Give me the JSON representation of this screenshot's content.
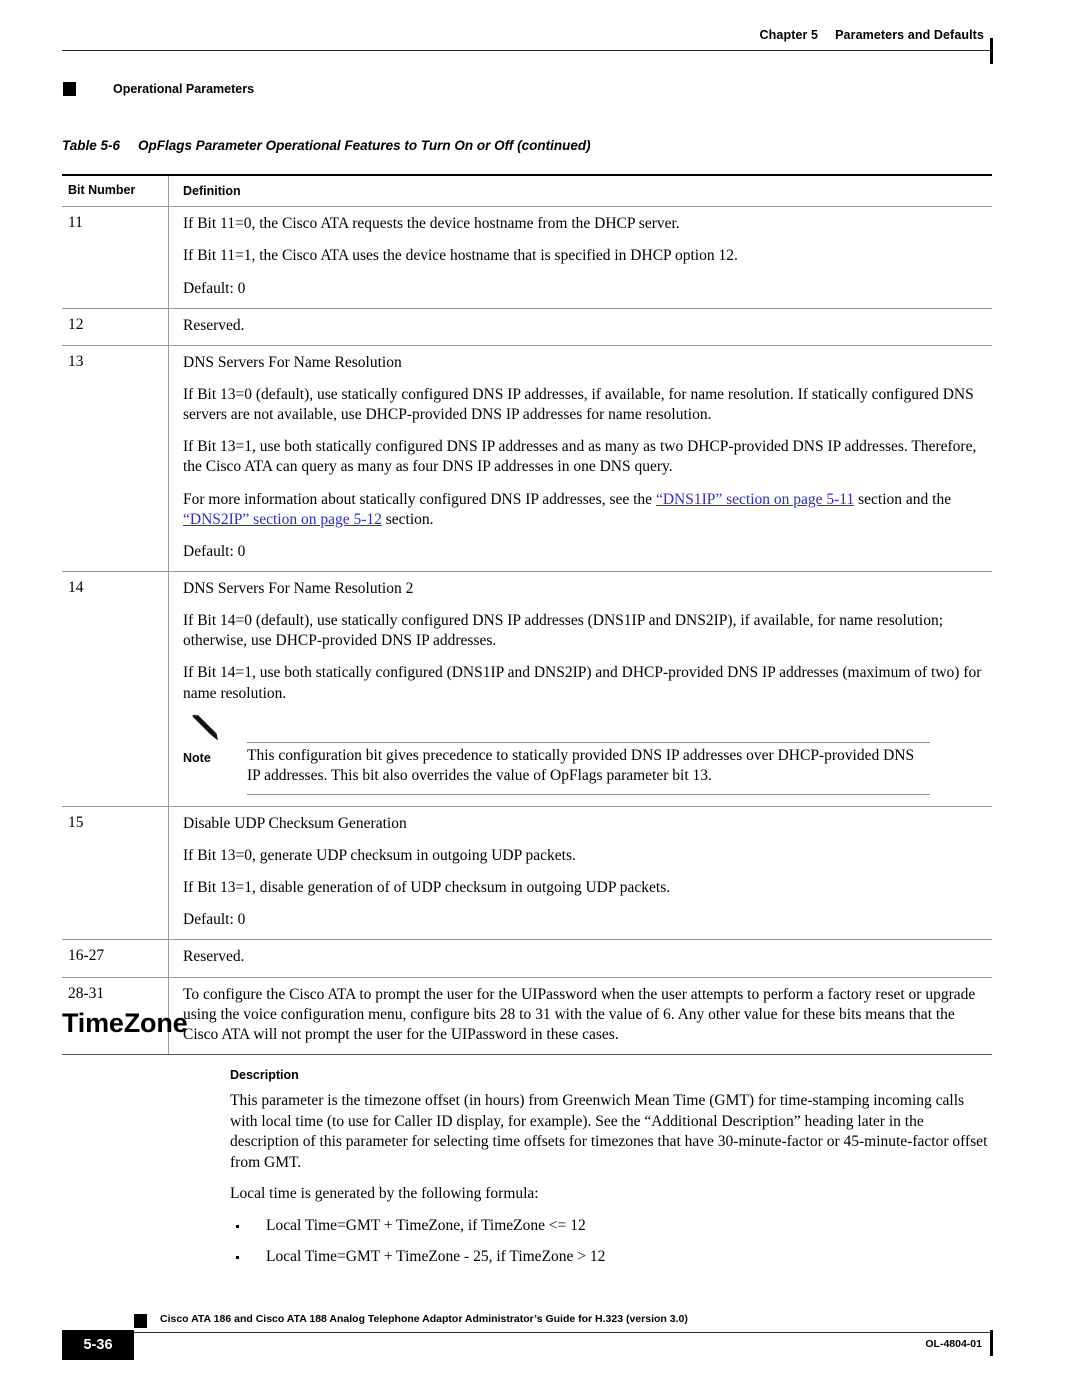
{
  "header": {
    "chapter": "Chapter 5",
    "chapter_title": "Parameters and Defaults",
    "section": "Operational Parameters",
    "square_icon": "black-square-icon"
  },
  "table": {
    "caption_number": "Table 5-6",
    "caption_title": "OpFlags Parameter Operational Features to Turn On or Off  (continued)",
    "columns": [
      "Bit Number",
      "Definition"
    ],
    "rows": [
      {
        "bit": "11",
        "paragraphs": [
          "If Bit 11=0, the Cisco ATA requests the device hostname from the DHCP server.",
          "If Bit 11=1, the Cisco ATA uses the device hostname that is specified in DHCP option 12.",
          "Default: 0"
        ]
      },
      {
        "bit": "12",
        "paragraphs": [
          "Reserved."
        ]
      },
      {
        "bit": "13",
        "paragraphs": [
          "DNS Servers For Name Resolution",
          "If Bit 13=0 (default), use statically configured DNS IP addresses, if available, for name resolution. If statically configured DNS servers are not available, use DHCP-provided DNS IP addresses for name resolution.",
          "If Bit 13=1, use both statically configured DNS IP addresses and as many as two DHCP-provided DNS IP addresses. Therefore, the Cisco ATA can query as many as four DNS IP addresses in one DNS query.",
          "Default: 0"
        ],
        "link_paragraph": {
          "pre": "For more information about statically configured DNS IP addresses, see the ",
          "link1": "“DNS1IP” section on page 5-11",
          "mid": " section and the ",
          "link2": "“DNS2IP” section on page 5-12",
          "post": " section."
        }
      },
      {
        "bit": "14",
        "paragraphs": [
          "DNS Servers For Name Resolution 2",
          "If Bit 14=0 (default), use statically configured DNS IP addresses (DNS1IP and DNS2IP), if available, for name resolution; otherwise, use DHCP-provided DNS IP addresses.",
          "If Bit 14=1, use both statically configured (DNS1IP and DNS2IP) and DHCP-provided DNS IP addresses (maximum of two) for name resolution."
        ],
        "note": {
          "icon": "pencil-icon",
          "label": "Note",
          "text": "This configuration bit gives precedence to statically provided DNS IP addresses over DHCP-provided DNS IP addresses. This bit also overrides the value of OpFlags parameter bit 13."
        }
      },
      {
        "bit": "15",
        "paragraphs": [
          "Disable UDP Checksum Generation",
          "If Bit 13=0, generate UDP checksum in outgoing UDP packets.",
          "If Bit 13=1, disable generation of of UDP checksum in outgoing UDP packets.",
          "Default: 0"
        ]
      },
      {
        "bit": "16-27",
        "paragraphs": [
          "Reserved."
        ]
      },
      {
        "bit": "28-31",
        "paragraphs": [
          "To configure the Cisco ATA to prompt the user for the UIPassword when the user attempts to perform a factory reset or upgrade using the voice configuration menu, configure bits 28 to 31 with the value of 6. Any other value for these bits means that the Cisco ATA will not prompt the user for the UIPassword in these cases."
        ]
      }
    ]
  },
  "section": {
    "heading": "TimeZone",
    "subheading": "Description",
    "paragraphs": [
      "This parameter is the timezone offset (in hours) from Greenwich Mean Time (GMT) for time-stamping incoming calls with local time (to use for Caller ID display, for example). See the “Additional Description” heading later in the description of this parameter for selecting time offsets for timezones that have 30-minute-factor or 45-minute-factor offset from GMT.",
      "Local time is generated by the following formula:"
    ],
    "bullets": [
      "Local Time=GMT + TimeZone, if TimeZone <= 12",
      "Local Time=GMT + TimeZone - 25, if TimeZone > 12"
    ]
  },
  "footer": {
    "guide_title": "Cisco ATA 186 and Cisco ATA 188 Analog Telephone Adaptor Administrator’s Guide for H.323 (version 3.0)",
    "page_number": "5-36",
    "doc_id": "OL-4804-01"
  },
  "colors": {
    "link": "#2b2bd6",
    "rule": "#9a9a9a",
    "text": "#000000"
  }
}
